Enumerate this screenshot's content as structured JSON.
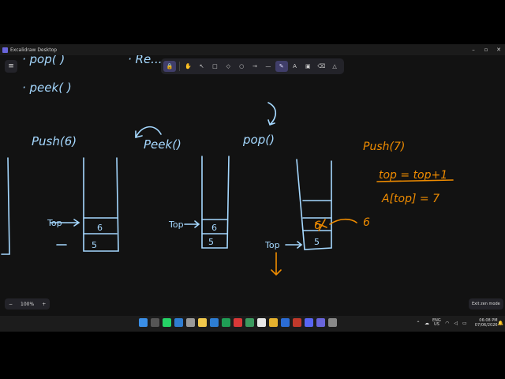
{
  "window": {
    "title": "Excalidraw Desktop",
    "controls": {
      "minimize": "–",
      "maximize": "▫",
      "close": "✕"
    }
  },
  "toolbar": {
    "tools": [
      {
        "name": "lock-icon",
        "glyph": "🔒"
      },
      {
        "name": "hand-icon",
        "glyph": "✋"
      },
      {
        "name": "selection-icon",
        "glyph": "↖"
      },
      {
        "name": "rectangle-icon",
        "glyph": "□"
      },
      {
        "name": "diamond-icon",
        "glyph": "◇"
      },
      {
        "name": "ellipse-icon",
        "glyph": "○"
      },
      {
        "name": "arrow-icon",
        "glyph": "→"
      },
      {
        "name": "line-icon",
        "glyph": "—"
      },
      {
        "name": "pencil-icon",
        "glyph": "✎"
      },
      {
        "name": "text-icon",
        "glyph": "A"
      },
      {
        "name": "image-icon",
        "glyph": "▣"
      },
      {
        "name": "eraser-icon",
        "glyph": "⌫"
      },
      {
        "name": "more-tools-icon",
        "glyph": "△"
      }
    ],
    "active_tool": "pencil-icon"
  },
  "zoom": {
    "minus": "−",
    "level": "100%",
    "plus": "+"
  },
  "exit_zen": "Exit zen mode",
  "drawing": {
    "top_text": {
      "pop": "· pop( )",
      "peek": "· peek( )",
      "re": "· Re... "
    },
    "push6": "Push(6)",
    "peek_label": "Peek()",
    "pop_label": "pop()",
    "top_label": "Top",
    "stack_values": {
      "six": "6",
      "five": "5"
    },
    "push7": "Push(7)",
    "top_eq": "top = top+1",
    "assign": "A[top] = 7",
    "popped": "6"
  },
  "taskbar": {
    "lang": "ENG",
    "region": "US",
    "time": "06:08 PM",
    "date": "07/06/2026"
  },
  "colors": {
    "ink_blue": "#a5d8ff",
    "ink_orange": "#f08c00",
    "canvas_bg": "#121212"
  }
}
